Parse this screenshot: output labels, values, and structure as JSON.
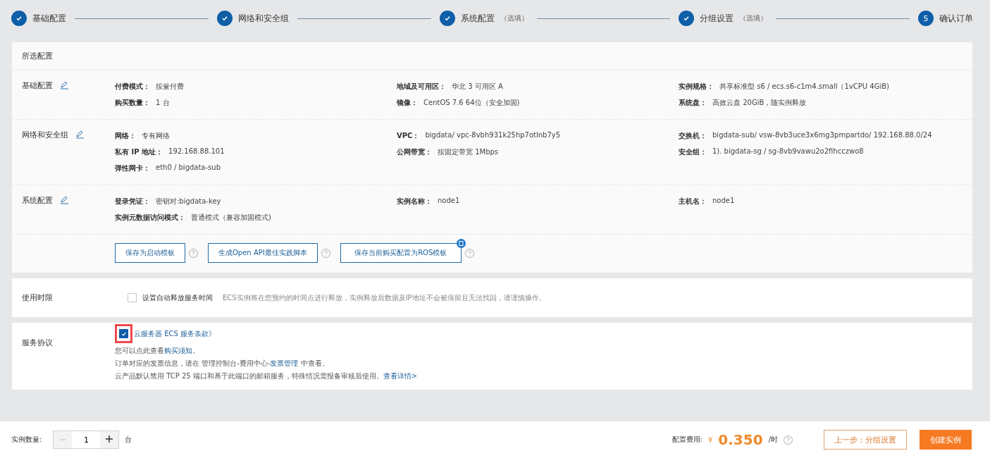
{
  "steps": [
    {
      "label": "基础配置",
      "done": true
    },
    {
      "label": "网络和安全组",
      "done": true
    },
    {
      "label": "系统配置",
      "hint": "（选填）",
      "done": true
    },
    {
      "label": "分组设置",
      "hint": "（选填）",
      "done": true
    },
    {
      "label": "确认订单",
      "number": "5",
      "done": false
    }
  ],
  "summary": {
    "title": "所选配置",
    "groups": [
      {
        "title": "基础配置",
        "fields": [
          {
            "label": "付费模式：",
            "value": "按量付费"
          },
          {
            "label": "地域及可用区：",
            "value": "华北 3 可用区 A"
          },
          {
            "label": "实例规格：",
            "value": "共享标准型 s6 / ecs.s6-c1m4.small（1vCPU 4GiB)"
          },
          {
            "label": "购买数量：",
            "value": "1 台"
          },
          {
            "label": "镜像：",
            "value": "CentOS 7.6 64位（安全加固)"
          },
          {
            "label": "系统盘：",
            "value": "高效云盘 20GiB，随实例释放"
          }
        ]
      },
      {
        "title": "网络和安全组",
        "fields": [
          {
            "label": "网络：",
            "value": "专有网络"
          },
          {
            "label": "VPC：",
            "value": "bigdata/ vpc-8vbh931k25hp7otlnb7y5"
          },
          {
            "label": "交换机：",
            "value": "bigdata-sub/ vsw-8vb3uce3x6mg3pmpartdo/ 192.168.88.0/24"
          },
          {
            "label": "私有 IP 地址：",
            "value": "192.168.88.101"
          },
          {
            "label": "公网带宽：",
            "value": "按固定带宽 1Mbps"
          },
          {
            "label": "安全组：",
            "value": "1). bigdata-sg / sg-8vb9vawu2o2fihcczwo8"
          },
          {
            "label": "弹性网卡：",
            "value": "eth0 / bigdata-sub"
          }
        ]
      },
      {
        "title": "系统配置",
        "fields": [
          {
            "label": "登录凭证：",
            "value": "密钥对:bigdata-key"
          },
          {
            "label": "实例名称：",
            "value": "node1"
          },
          {
            "label": "主机名：",
            "value": "node1"
          },
          {
            "label": "实例元数据访问模式：",
            "value": "普通模式（兼容加固模式)"
          }
        ]
      }
    ],
    "actions": [
      {
        "label": "保存为启动模板",
        "new": false
      },
      {
        "label": "生成Open API最佳实践脚本",
        "new": false
      },
      {
        "label": "保存当前购买配置为ROS模板",
        "new": true
      }
    ]
  },
  "usage": {
    "title": "使用时限",
    "checkbox": {
      "label": "设置自动释放服务时间",
      "checked": false
    },
    "note": "ECS实例将在您预约的时间点进行释放，实例释放后数据及IP地址不会被保留且无法找回，请谨慎操作。"
  },
  "agreement": {
    "title": "服务协议",
    "checked": true,
    "highlighted": true,
    "terms_link": "云服务器 ECS 服务条款》",
    "lines": [
      [
        {
          "text": "您可以点此查看",
          "link": false
        },
        {
          "text": "购买须知",
          "link": true
        },
        {
          "text": "。",
          "link": false
        }
      ],
      [
        {
          "text": "订单对应的发票信息，请在 管理控制台-费用中心-",
          "link": false
        },
        {
          "text": "发票管理",
          "link": true
        },
        {
          "text": " 中查看。",
          "link": false
        }
      ],
      [
        {
          "text": "云产品默认禁用 TCP 25 端口和基于此端口的邮箱服务，特殊情况需报备审核后使用。",
          "link": false
        },
        {
          "text": "查看详情>",
          "link": true
        }
      ]
    ]
  },
  "footer": {
    "quantity_label": "实例数量:",
    "quantity": "1",
    "unit": "台",
    "cost_label": "配置费用:",
    "currency": "¥",
    "price": "0.350",
    "price_unit": "/时",
    "prev_button": "上一步：分组设置",
    "create_button": "创建实例"
  }
}
